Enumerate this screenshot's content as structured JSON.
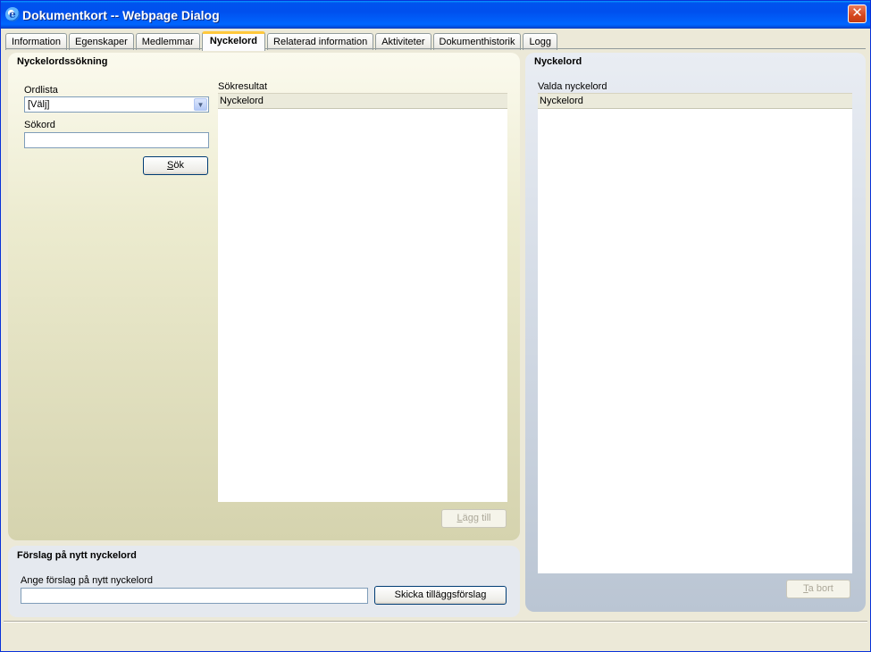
{
  "window": {
    "title": "Dokumentkort -- Webpage Dialog",
    "close_symbol": "✕",
    "icon_letter": "e"
  },
  "tabs": [
    {
      "label": "Information",
      "active": false
    },
    {
      "label": "Egenskaper",
      "active": false
    },
    {
      "label": "Medlemmar",
      "active": false
    },
    {
      "label": "Nyckelord",
      "active": true
    },
    {
      "label": "Relaterad information",
      "active": false
    },
    {
      "label": "Aktiviteter",
      "active": false
    },
    {
      "label": "Dokumenthistorik",
      "active": false
    },
    {
      "label": "Logg",
      "active": false
    }
  ],
  "search": {
    "title": "Nyckelordssökning",
    "wordlist_label": "Ordlista",
    "wordlist_value": "[Välj]",
    "searchword_label": "Sökord",
    "searchword_value": "",
    "search_button_accel": "S",
    "search_button_rest": "ök",
    "results_label": "Sökresultat",
    "results_header": "Nyckelord",
    "add_button_accel": "L",
    "add_button_rest": "ägg till"
  },
  "suggest": {
    "title": "Förslag på nytt nyckelord",
    "input_label": "Ange förslag på nytt nyckelord",
    "input_value": "",
    "send_button": "Skicka tilläggsförslag"
  },
  "keywords": {
    "title": "Nyckelord",
    "selected_label": "Valda nyckelord",
    "list_header": "Nyckelord",
    "remove_button_accel": "T",
    "remove_button_rest": "a bort"
  },
  "colors": {
    "titlebar": "#0053ee",
    "active_tab_accent": "#ffc83c",
    "search_panel": "#d5d3ae",
    "keywords_panel": "#bac5d3"
  }
}
